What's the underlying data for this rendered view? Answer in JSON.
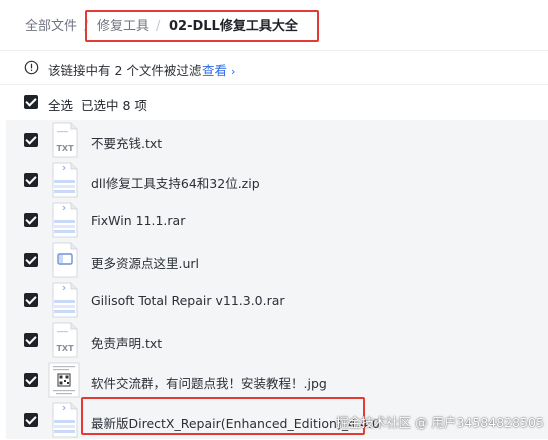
{
  "breadcrumb": {
    "items": [
      "全部文件",
      "修复工具",
      "02-DLL修复工具大全"
    ],
    "separator": "/"
  },
  "filter_notice": {
    "text": "该链接中有 2 个文件被过滤",
    "link": "查看",
    "link_chevron": "›"
  },
  "selection": {
    "select_all": "全选",
    "count": "已选中  8  项"
  },
  "files": [
    {
      "name": "不要充钱.txt",
      "icon": "txt-file-icon",
      "badge": "TXT"
    },
    {
      "name": "dll修复工具支持64和32位.zip",
      "icon": "archive-file-icon"
    },
    {
      "name": "FixWin 11.1.rar",
      "icon": "archive-file-icon"
    },
    {
      "name": "更多资源点这里.url",
      "icon": "url-file-icon"
    },
    {
      "name": "Gilisoft Total Repair v11.3.0.rar",
      "icon": "archive-file-icon"
    },
    {
      "name": "免责声明.txt",
      "icon": "txt-file-icon",
      "badge": "TXT"
    },
    {
      "name": "软件交流群，有问题点我！安装教程！.jpg",
      "icon": "image-thumbnail-icon"
    },
    {
      "name": "最新版DirectX_Repair(Enhanced_Edition)_4.4.0",
      "icon": "archive-file-icon"
    }
  ],
  "watermark": "掘金技术社区 @ 用户34584828505",
  "colors": {
    "link": "#2e6ae6",
    "checkbox": "#1f2329",
    "highlight_box": "#e53935",
    "list_background": "#f4f5f7"
  }
}
